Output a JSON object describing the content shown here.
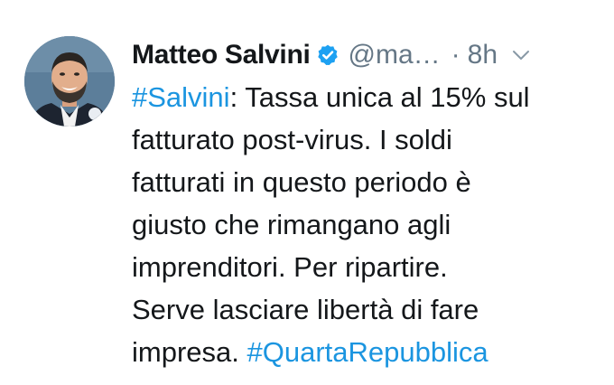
{
  "tweet": {
    "author_name": "Matteo Salvini",
    "handle": "@ma…",
    "separator": "·",
    "time": "8h",
    "lines": [
      {
        "hashtag": "#Salvini",
        "text": ": Tassa unica al 15% sul"
      },
      {
        "text": "fatturato post-virus. I soldi"
      },
      {
        "text": "fatturati in questo periodo è"
      },
      {
        "text": "giusto che rimangano agli"
      },
      {
        "text": "imprenditori. Per ripartire."
      },
      {
        "text": "Serve lasciare libertà di fare"
      },
      {
        "text": "impresa. ",
        "hashtag_end": "#QuartaRepubblica"
      }
    ]
  },
  "icons": {
    "verified": "verified-badge-icon",
    "more": "chevron-down-icon"
  },
  "colors": {
    "text": "#14171a",
    "secondary": "#657786",
    "link": "#1b95e0",
    "verified": "#1da1f2"
  }
}
